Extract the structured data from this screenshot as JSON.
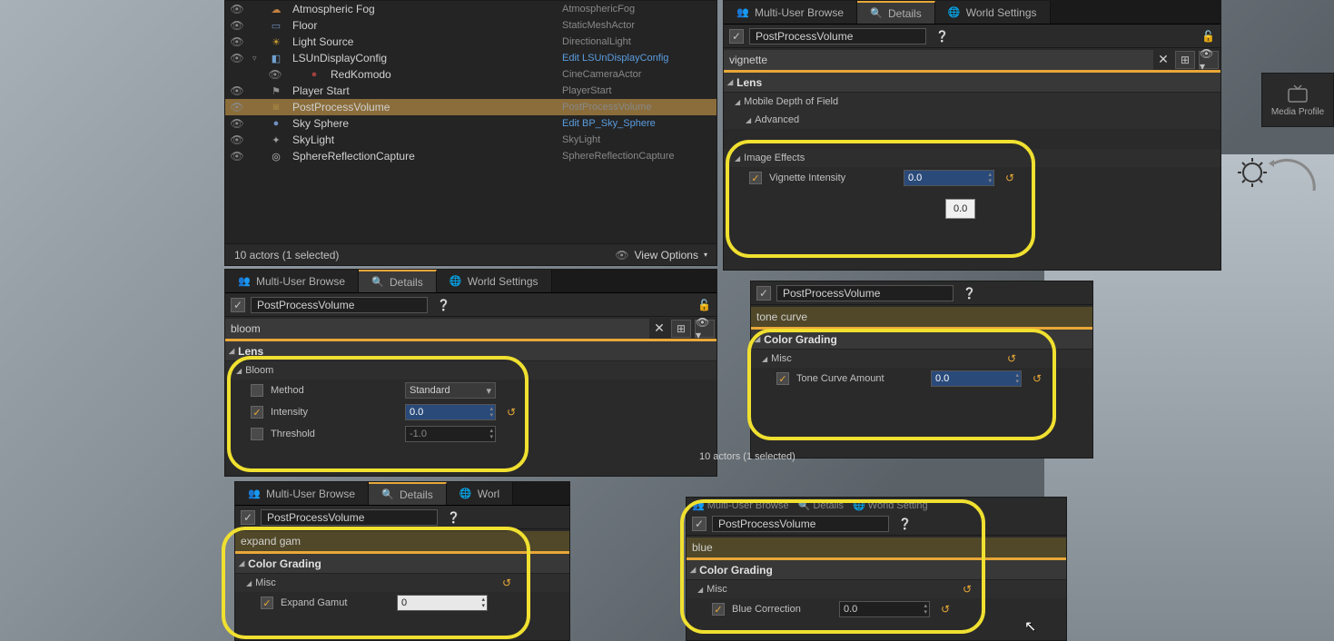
{
  "outliner": {
    "rows": [
      {
        "name": "Atmospheric Fog",
        "type": "AtmosphericFog",
        "icon": "☁",
        "color": "#c08040",
        "arrow": ""
      },
      {
        "name": "Floor",
        "type": "StaticMeshActor",
        "icon": "▭",
        "color": "#7090c0",
        "arrow": ""
      },
      {
        "name": "Light Source",
        "type": "DirectionalLight",
        "icon": "☀",
        "color": "#d0a030",
        "arrow": ""
      },
      {
        "name": "LSUnDisplayConfig",
        "type": "Edit LSUnDisplayConfig",
        "icon": "◧",
        "color": "#70a0d0",
        "arrow": "▿",
        "link": true
      },
      {
        "name": "RedKomodo",
        "type": "CineCameraActor",
        "icon": "●",
        "color": "#a04040",
        "arrow": "",
        "child": true
      },
      {
        "name": "Player Start",
        "type": "PlayerStart",
        "icon": "⚑",
        "color": "#909090",
        "arrow": ""
      },
      {
        "name": "PostProcessVolume",
        "type": "PostProcessVolume",
        "icon": "◙",
        "color": "#a08040",
        "arrow": "",
        "sel": true
      },
      {
        "name": "Sky Sphere",
        "type": "Edit BP_Sky_Sphere",
        "icon": "●",
        "color": "#7090c0",
        "arrow": "",
        "link": true
      },
      {
        "name": "SkyLight",
        "type": "SkyLight",
        "icon": "✦",
        "color": "#a0a0a0",
        "arrow": ""
      },
      {
        "name": "SphereReflectionCapture",
        "type": "SphereReflectionCapture",
        "icon": "◎",
        "color": "#c0c0c0",
        "arrow": ""
      }
    ],
    "footer_count": "10 actors (1 selected)",
    "view_options": "View Options"
  },
  "tabs": {
    "multiuser": "Multi-User Browse",
    "details": "Details",
    "world": "World Settings"
  },
  "object_name": "PostProcessVolume",
  "panel1": {
    "search": "vignette",
    "cat_lens": "Lens",
    "sub_mdof": "Mobile Depth of Field",
    "sub_adv": "Advanced",
    "sub_imgfx": "Image Effects",
    "prop_vig": "Vignette Intensity",
    "val_vig": "0.0",
    "tooltip": "0.0"
  },
  "panel2": {
    "search": "bloom",
    "cat_lens": "Lens",
    "sub_bloom": "Bloom",
    "prop_method": "Method",
    "val_method": "Standard",
    "prop_intensity": "Intensity",
    "val_intensity": "0.0",
    "prop_threshold": "Threshold",
    "val_threshold": "-1.0"
  },
  "panel3": {
    "search": "tone curve",
    "cat": "Color Grading",
    "sub": "Misc",
    "prop": "Tone Curve Amount",
    "val": "0.0"
  },
  "panel4": {
    "search": "expand gam",
    "cat": "Color Grading",
    "sub": "Misc",
    "prop": "Expand Gamut",
    "val": "0"
  },
  "panel5": {
    "search": "blue",
    "cat": "Color Grading",
    "sub": "Misc",
    "prop": "Blue Correction",
    "val": "0.0"
  },
  "footer_actors": "10 actors (1 selected)",
  "world_short": "Worl",
  "world_cut": "World Setting",
  "media_profile": "Media Profile"
}
